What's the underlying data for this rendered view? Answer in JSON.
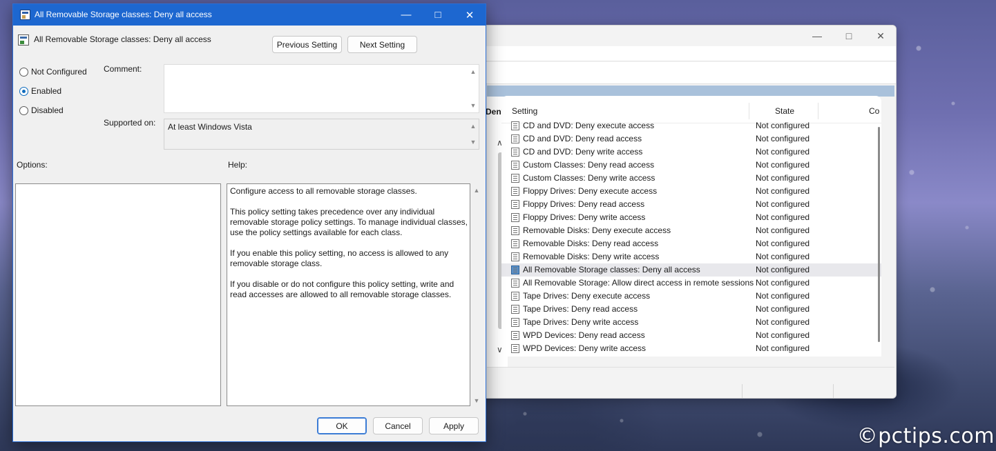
{
  "dialog": {
    "title": "All Removable Storage classes: Deny all access",
    "header_title": "All Removable Storage classes: Deny all access",
    "previous_label": "Previous Setting",
    "next_label": "Next Setting",
    "radios": [
      {
        "label": "Not Configured",
        "checked": false
      },
      {
        "label": "Enabled",
        "checked": true
      },
      {
        "label": "Disabled",
        "checked": false
      }
    ],
    "comment_label": "Comment:",
    "comment_value": "",
    "supported_label": "Supported on:",
    "supported_value": "At least Windows Vista",
    "options_label": "Options:",
    "help_label": "Help:",
    "help_paragraphs": [
      "Configure access to all removable storage classes.",
      "This policy setting takes precedence over any individual removable storage policy settings. To manage individual classes, use the policy settings available for each class.",
      "If you enable this policy setting, no access is allowed to any removable storage class.",
      "If you disable or do not configure this policy setting, write and read accesses are allowed to all removable storage classes."
    ],
    "ok_label": "OK",
    "cancel_label": "Cancel",
    "apply_label": "Apply"
  },
  "background_window": {
    "left_pane_label": "Deny",
    "columns": {
      "setting": "Setting",
      "state": "State",
      "comment": "Co"
    },
    "rows": [
      {
        "name": "CD and DVD: Deny execute access",
        "state": "Not configured",
        "selected": false
      },
      {
        "name": "CD and DVD: Deny read access",
        "state": "Not configured",
        "selected": false
      },
      {
        "name": "CD and DVD: Deny write access",
        "state": "Not configured",
        "selected": false
      },
      {
        "name": "Custom Classes: Deny read access",
        "state": "Not configured",
        "selected": false
      },
      {
        "name": "Custom Classes: Deny write access",
        "state": "Not configured",
        "selected": false
      },
      {
        "name": "Floppy Drives: Deny execute access",
        "state": "Not configured",
        "selected": false
      },
      {
        "name": "Floppy Drives: Deny read access",
        "state": "Not configured",
        "selected": false
      },
      {
        "name": "Floppy Drives: Deny write access",
        "state": "Not configured",
        "selected": false
      },
      {
        "name": "Removable Disks: Deny execute access",
        "state": "Not configured",
        "selected": false
      },
      {
        "name": "Removable Disks: Deny read access",
        "state": "Not configured",
        "selected": false
      },
      {
        "name": "Removable Disks: Deny write access",
        "state": "Not configured",
        "selected": false
      },
      {
        "name": "All Removable Storage classes: Deny all access",
        "state": "Not configured",
        "selected": true
      },
      {
        "name": "All Removable Storage: Allow direct access in remote sessions",
        "state": "Not configured",
        "selected": false
      },
      {
        "name": "Tape Drives: Deny execute access",
        "state": "Not configured",
        "selected": false
      },
      {
        "name": "Tape Drives: Deny read access",
        "state": "Not configured",
        "selected": false
      },
      {
        "name": "Tape Drives: Deny write access",
        "state": "Not configured",
        "selected": false
      },
      {
        "name": "WPD Devices: Deny read access",
        "state": "Not configured",
        "selected": false
      },
      {
        "name": "WPD Devices: Deny write access",
        "state": "Not configured",
        "selected": false
      }
    ]
  },
  "watermark": "©pctips.com",
  "icons": {
    "minimize": "minimize-icon",
    "maximize": "maximize-icon",
    "close": "close-icon",
    "policy": "policy-setting-icon"
  },
  "colors": {
    "titlebar": "#1d67d0",
    "accent": "#0f6cbd",
    "selected_row": "#e8e8ec"
  }
}
